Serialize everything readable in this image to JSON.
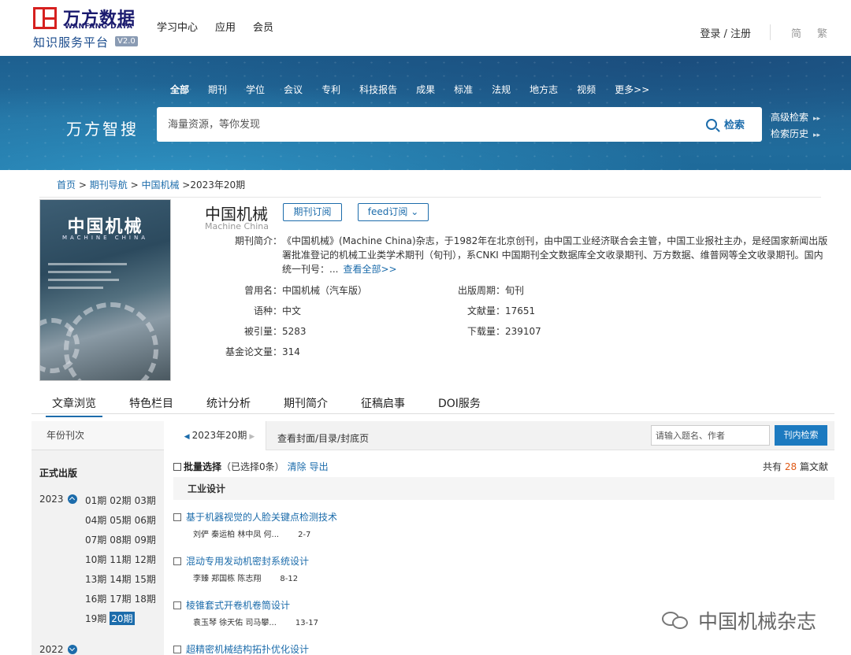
{
  "header": {
    "logo_cn": "万方数据",
    "logo_en": "WANFANG DATA",
    "logo_sub": "知识服务平台",
    "logo_version": "V2.0",
    "nav": [
      "学习中心",
      "应用",
      "会员"
    ],
    "login": "登录 / 注册",
    "lang_simplified": "简",
    "lang_traditional": "繁"
  },
  "search": {
    "brand": "万方智搜",
    "categories": [
      "全部",
      "期刊",
      "学位",
      "会议",
      "专利",
      "科技报告",
      "成果",
      "标准",
      "法规",
      "地方志",
      "视频",
      "更多>>"
    ],
    "active_category": "全部",
    "placeholder": "海量资源，等你发现",
    "button": "检索",
    "advanced": "高级检索",
    "history": "检索历史"
  },
  "breadcrumb": {
    "home": "首页",
    "nav": "期刊导航",
    "journal": "中国机械",
    "current": ">2023年20期"
  },
  "journal": {
    "cover_title": "中国机械",
    "cover_en": "MACHINE CHINA",
    "title": "中国机械",
    "subtitle": "Machine China",
    "subscribe_btn": "期刊订阅",
    "feed_btn": "feed订阅",
    "intro_label": "期刊简介：",
    "intro_text": "《中国机械》(Machine China)杂志，于1982年在北京创刊，由中国工业经济联合会主管，中国工业报社主办，是经国家新闻出版署批准登记的机械工业类学术期刊（旬刊），系CNKI 中国期刊全文数据库全文收录期刊、万方数据、维普网等全文收录期刊。国内统一刊号：...",
    "intro_more": "查看全部>>",
    "former_name_label": "曾用名：",
    "former_name": "中国机械（汽车版）",
    "cycle_label": "出版周期：",
    "cycle": "旬刊",
    "language_label": "语种：",
    "language": "中文",
    "docs_label": "文献量：",
    "docs": "17651",
    "cited_label": "被引量：",
    "cited": "5283",
    "downloads_label": "下载量：",
    "downloads": "239107",
    "fund_label": "基金论文量：",
    "fund": "314"
  },
  "tabs": [
    "文章浏览",
    "特色栏目",
    "统计分析",
    "期刊简介",
    "征稿启事",
    "DOI服务"
  ],
  "sidebar": {
    "header": "年份刊次",
    "section": "正式出版",
    "year_2023": "2023",
    "year_2022": "2022",
    "issues": [
      [
        "01期",
        "02期",
        "03期"
      ],
      [
        "04期",
        "05期",
        "06期"
      ],
      [
        "07期",
        "08期",
        "09期"
      ],
      [
        "10期",
        "11期",
        "12期"
      ],
      [
        "13期",
        "14期",
        "15期"
      ],
      [
        "16期",
        "17期",
        "18期"
      ],
      [
        "19期",
        "20期"
      ]
    ],
    "current_issue": "20期"
  },
  "issue_bar": {
    "current": "2023年20期",
    "view_link": "查看封面/目录/封底页",
    "search_placeholder": "请输入题名、作者",
    "search_button": "刊内检索"
  },
  "list": {
    "batch_label": "批量选择",
    "selected": "（已选择0条）",
    "clear": "清除",
    "export": "导出",
    "total_prefix": "共有",
    "total_count": "28",
    "total_suffix": "篇文献",
    "section": "工业设计",
    "articles": [
      {
        "title": "基于机器视觉的人脸关键点检测技术",
        "authors": "刘俨 秦运柏 林中凤 何...",
        "pages": "2-7"
      },
      {
        "title": "混动专用发动机密封系统设计",
        "authors": "李臻 郑国栋 陈志翔",
        "pages": "8-12"
      },
      {
        "title": "棱锥套式开卷机卷筒设计",
        "authors": "袁玉琴 徐天佑 司马攀...",
        "pages": "13-17"
      },
      {
        "title": "超精密机械结构拓扑优化设计",
        "authors": "",
        "pages": ""
      }
    ]
  },
  "watermark": "中国机械杂志",
  "colors": {
    "accent": "#1c6cab",
    "brand_red": "#d6201f",
    "count_orange": "#e05a16"
  }
}
